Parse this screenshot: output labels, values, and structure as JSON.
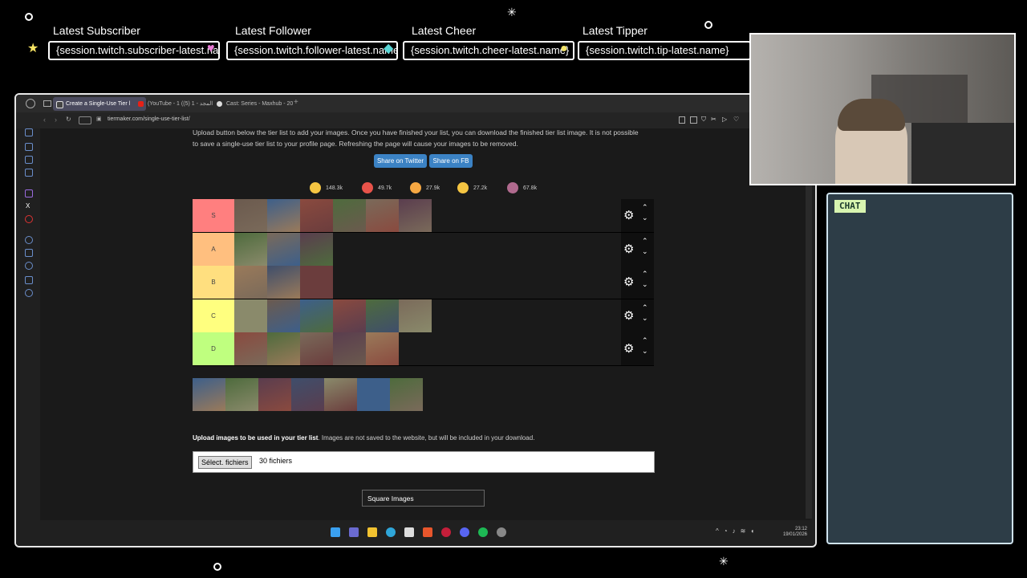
{
  "overlay": {
    "alerts": [
      {
        "title": "Latest Subscriber",
        "value": "{session.twitch.subscriber-latest.name}",
        "icon": "star-icon"
      },
      {
        "title": "Latest Follower",
        "value": "{session.twitch.follower-latest.name}",
        "icon": "heart-icon"
      },
      {
        "title": "Latest Cheer",
        "value": "{session.twitch.cheer-latest.name}",
        "icon": "gem-icon"
      },
      {
        "title": "Latest Tipper",
        "value": "{session.twitch.tip-latest.name}",
        "icon": "coin-icon"
      }
    ],
    "colors": {
      "star": "#f7e463",
      "heart": "#e97ad6",
      "gem": "#5ad6d6",
      "coin": "#f2e36a",
      "chat_bg": "#2d3d47",
      "chat_label_bg": "#d8f5b0"
    },
    "chat": {
      "label": "CHAT"
    }
  },
  "browser": {
    "tabs": [
      {
        "label": "Create a Single-Use Tier l",
        "icon": "tiermaker-icon"
      },
      {
        "label": "(YouTube - 1 (المجد - 1 (5)",
        "icon": "youtube-icon"
      },
      {
        "label": "Cast: Series - Maxhub - 20",
        "icon": "maxhub-icon"
      }
    ],
    "url": "tiermaker.com/single-use-tier-list/"
  },
  "page": {
    "intro_line1": "Upload button below the tier list to add your images. Once you have finished your list, you can download the finished tier list image. It is not possible",
    "intro_line2": "to save a single-use tier list to your profile page. Refreshing the page will cause your images to be removed.",
    "share_twitter": "Share on Twitter",
    "share_fb": "Share on FB",
    "reactions": [
      {
        "icon": "laugh-emoji-icon",
        "count": "148.3k",
        "color": "#f5c542"
      },
      {
        "icon": "love-emoji-icon",
        "count": "49.7k",
        "color": "#e8534a"
      },
      {
        "icon": "grin-emoji-icon",
        "count": "27.9k",
        "color": "#f5a742"
      },
      {
        "icon": "raised-hands-emoji-icon",
        "count": "27.2k",
        "color": "#f5c542"
      },
      {
        "icon": "poop-emoji-icon",
        "count": "67.8k",
        "color": "#b06a8e"
      }
    ],
    "tiers": [
      {
        "label": "S",
        "color": "#ff7f7f",
        "thumb_count": 6
      },
      {
        "label": "A",
        "color": "#ffbf7f",
        "thumb_count": 3
      },
      {
        "label": "B",
        "color": "#ffdf7f",
        "thumb_count": 3
      },
      {
        "label": "C",
        "color": "#ffff7f",
        "thumb_count": 6
      },
      {
        "label": "D",
        "color": "#bfff7f",
        "thumb_count": 5
      }
    ],
    "pool_count": 7,
    "upload_bold": "Upload images to be used in your tier list",
    "upload_rest": ". Images are not saved to the website, but will be included in your download.",
    "file_button": "Sélect. fichiers",
    "file_count": "30 fichiers",
    "select_value": "Square Images"
  },
  "taskbar": {
    "time": "23:12",
    "date": "19/01/2026"
  }
}
